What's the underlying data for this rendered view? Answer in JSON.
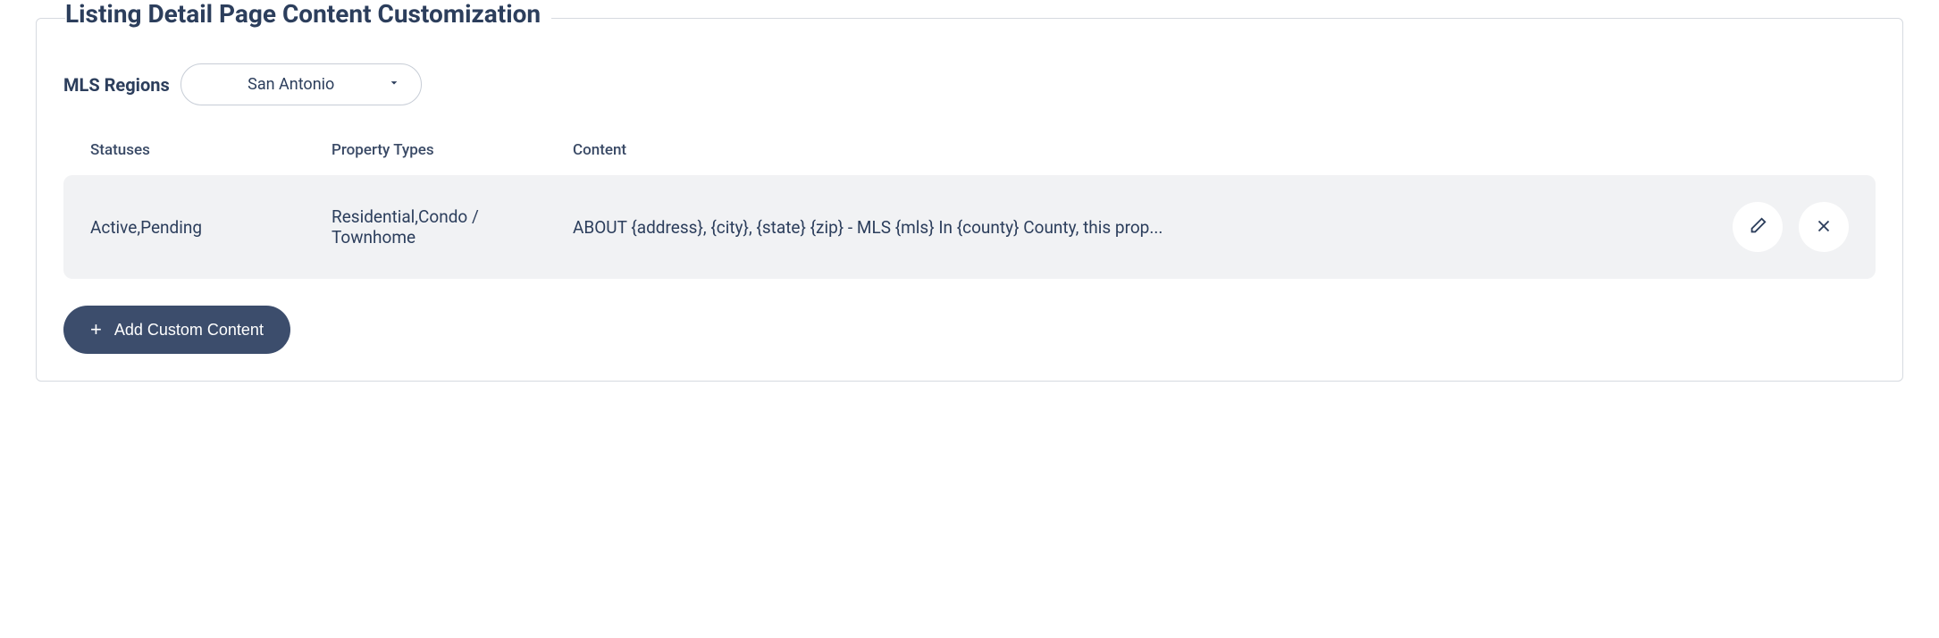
{
  "fieldset": {
    "title": "Listing Detail Page Content Customization"
  },
  "region": {
    "label": "MLS Regions",
    "selected": "San Antonio"
  },
  "table": {
    "headers": {
      "statuses": "Statuses",
      "propertyTypes": "Property Types",
      "content": "Content"
    },
    "rows": [
      {
        "statuses": "Active,Pending",
        "propertyTypes": "Residential,Condo / Townhome",
        "content": "ABOUT {address}, {city}, {state} {zip} - MLS {mls} In {county} County, this prop..."
      }
    ]
  },
  "addButton": {
    "label": "Add Custom Content"
  }
}
